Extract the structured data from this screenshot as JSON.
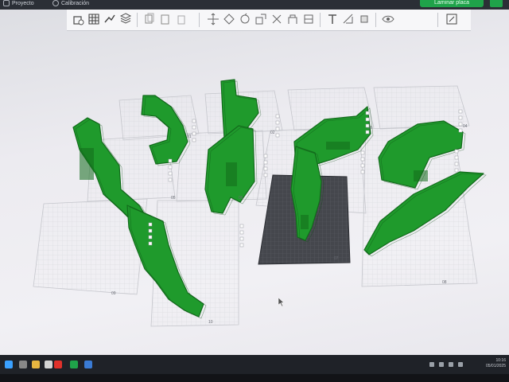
{
  "app": {
    "menu": [
      "Proyecto",
      "Calibración"
    ],
    "slice_button": "Laminar placa"
  },
  "toolbar": {
    "icons": [
      "add-object-icon",
      "grid-icon",
      "arrange-icon",
      "layers-icon",
      "copy-icon",
      "paste-icon",
      "delete-icon",
      "split-icon",
      "move-icon",
      "rotate-icon",
      "scale-icon",
      "cut-icon",
      "support-icon",
      "seam-icon",
      "text-icon",
      "measure-icon",
      "assembly-icon",
      "view-icon",
      "settings-icon"
    ]
  },
  "plates": [
    {
      "label": "01"
    },
    {
      "label": "02"
    },
    {
      "label": "03"
    },
    {
      "label": "04"
    },
    {
      "label": "05"
    },
    {
      "label": "06"
    },
    {
      "label": "07"
    },
    {
      "label": "08"
    },
    {
      "label": "09"
    },
    {
      "label": "10"
    }
  ],
  "clock": {
    "time": "10:16",
    "date": "05/01/2025"
  },
  "colors": {
    "model": "#1f9a2c",
    "model_dark": "#136b1c",
    "active_plate": "#3e4046",
    "accent": "#1fa34a"
  }
}
